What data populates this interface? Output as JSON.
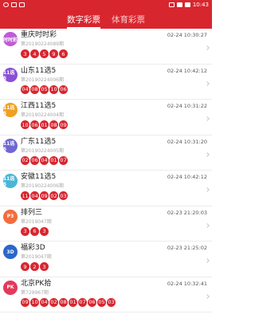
{
  "status_bar": {
    "time": "10:43"
  },
  "tabs": [
    {
      "label": "数字彩票",
      "active": true
    },
    {
      "label": "体育彩票",
      "active": false
    }
  ],
  "lotteries": [
    {
      "name": "重庆时时彩",
      "issue": "第20190224089期",
      "time": "02-24 10:30:27",
      "balls": [
        "3",
        "4",
        "5",
        "9",
        "6"
      ],
      "logo_color": "#c05bd6",
      "logo_text": "时时彩"
    },
    {
      "name": "山东11选5",
      "issue": "第20190224006期",
      "time": "02-24 10:42:12",
      "balls": [
        "04",
        "08",
        "05",
        "10",
        "06"
      ],
      "logo_color": "#8a4fd8",
      "logo_text": "11选5"
    },
    {
      "name": "江西11选5",
      "issue": "第20190224004期",
      "time": "02-24 10:31:22",
      "balls": [
        "10",
        "06",
        "01",
        "08",
        "09"
      ],
      "logo_color": "#f0a020",
      "logo_text": "11选5"
    },
    {
      "name": "广东11选5",
      "issue": "第20190224005期",
      "time": "02-24 10:31:20",
      "balls": [
        "02",
        "06",
        "04",
        "01",
        "07"
      ],
      "logo_color": "#6e67d3",
      "logo_text": "11选5"
    },
    {
      "name": "安徽11选5",
      "issue": "第20190224006期",
      "time": "02-24 10:42:12",
      "balls": [
        "11",
        "04",
        "09",
        "02",
        "03"
      ],
      "logo_color": "#47b6d8",
      "logo_text": "11选5"
    },
    {
      "name": "排列三",
      "issue": "第2019047期",
      "time": "02-23 21:20:03",
      "balls": [
        "3",
        "6",
        "3"
      ],
      "logo_color": "#f26d3d",
      "logo_text": "P3"
    },
    {
      "name": "福彩3D",
      "issue": "第2019047期",
      "time": "02-23 21:25:02",
      "balls": [
        "9",
        "2",
        "3"
      ],
      "logo_color": "#2b67c8",
      "logo_text": "3D"
    },
    {
      "name": "北京PK拾",
      "issue": "第729967期",
      "time": "02-24 10:32:41",
      "balls": [
        "09",
        "10",
        "04",
        "02",
        "08",
        "01",
        "07",
        "06",
        "05",
        "03"
      ],
      "logo_color": "#e33a5a",
      "logo_text": "PK"
    }
  ]
}
